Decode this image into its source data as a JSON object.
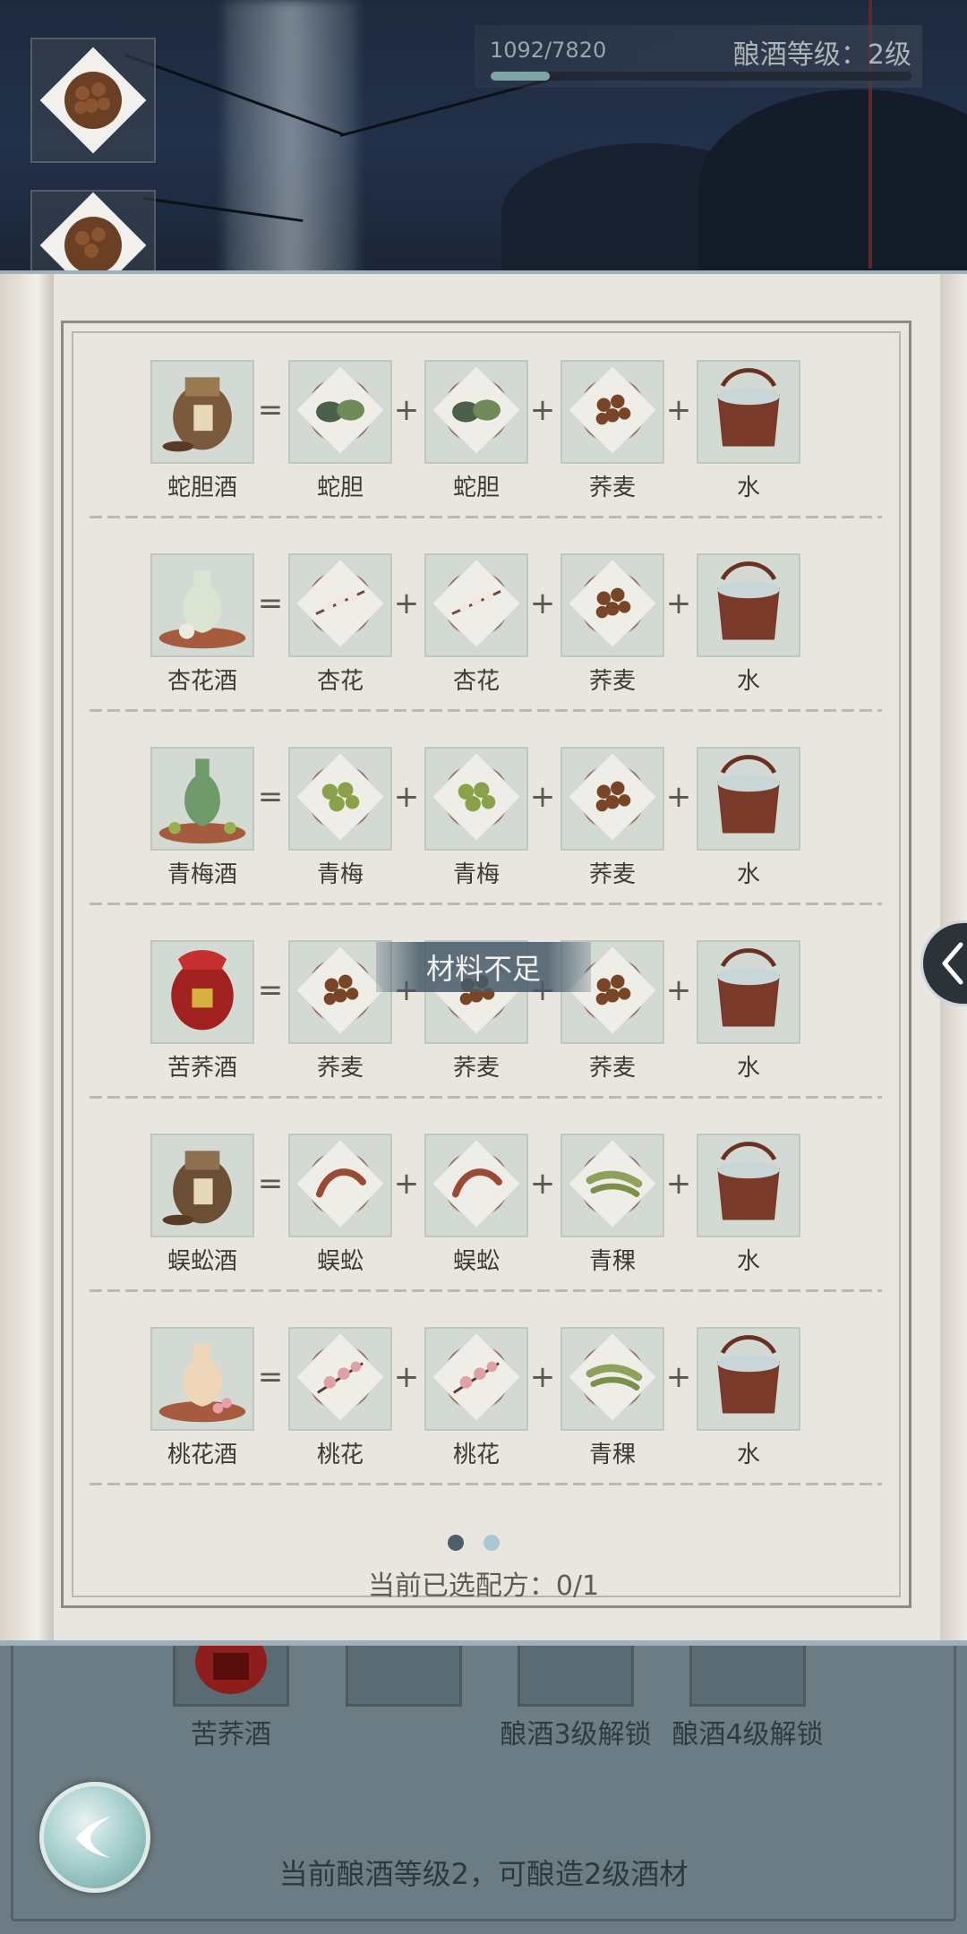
{
  "header": {
    "progress_text": "1092/7820",
    "progress_fraction": 0.1396,
    "level_label": "酿酒等级：2级"
  },
  "recipes": [
    {
      "result": "蛇胆酒",
      "ingredients": [
        "蛇胆",
        "蛇胆",
        "荞麦",
        "水"
      ]
    },
    {
      "result": "杏花酒",
      "ingredients": [
        "杏花",
        "杏花",
        "荞麦",
        "水"
      ]
    },
    {
      "result": "青梅酒",
      "ingredients": [
        "青梅",
        "青梅",
        "荞麦",
        "水"
      ]
    },
    {
      "result": "苦荞酒",
      "ingredients": [
        "荞麦",
        "荞麦",
        "荞麦",
        "水"
      ]
    },
    {
      "result": "蜈蚣酒",
      "ingredients": [
        "蜈蚣",
        "蜈蚣",
        "青稞",
        "水"
      ]
    },
    {
      "result": "桃花酒",
      "ingredients": [
        "桃花",
        "桃花",
        "青稞",
        "水"
      ]
    }
  ],
  "operators": {
    "equals": "=",
    "plus": "+"
  },
  "toast": "材料不足",
  "pager": {
    "pages": 2,
    "current": 0
  },
  "selected_count": "当前已选配方：0/1",
  "bottom": {
    "slots": [
      "苦荞酒",
      "",
      "酿酒3级解锁",
      "酿酒4级解锁"
    ],
    "info": "当前酿酒等级2，可酿造2级酒材"
  },
  "colors": {
    "paper": "#e9e6e0",
    "tile": "#d3d9d3",
    "accent": "#7fa6a6",
    "dot_active": "#4d6069",
    "dot_inactive": "#a9c9d2"
  }
}
